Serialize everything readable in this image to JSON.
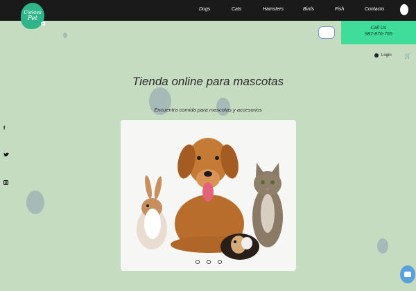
{
  "brand": {
    "line1": "Cieloss",
    "line2": "Pet"
  },
  "nav": {
    "items": [
      "Dogs",
      "Cats",
      "Hamsters",
      "Birds",
      "Fish",
      "Contacto"
    ]
  },
  "call": {
    "title": "Call Us",
    "phone": "987-876-765"
  },
  "account": {
    "login_label": "Login"
  },
  "hero": {
    "title": "Tienda online para mascotas",
    "subtitle": "Encuentra comida para mascotas y accesorios"
  },
  "social": {
    "icons": [
      "facebook-icon",
      "twitter-icon",
      "instagram-icon"
    ]
  },
  "carousel": {
    "slides_count": 3,
    "active_index": 0
  },
  "colors": {
    "background": "#c6dcc0",
    "topbar": "#1a1a1a",
    "accent": "#40dc9a",
    "logo": "#2fb589",
    "chat": "#5aa0dc"
  }
}
